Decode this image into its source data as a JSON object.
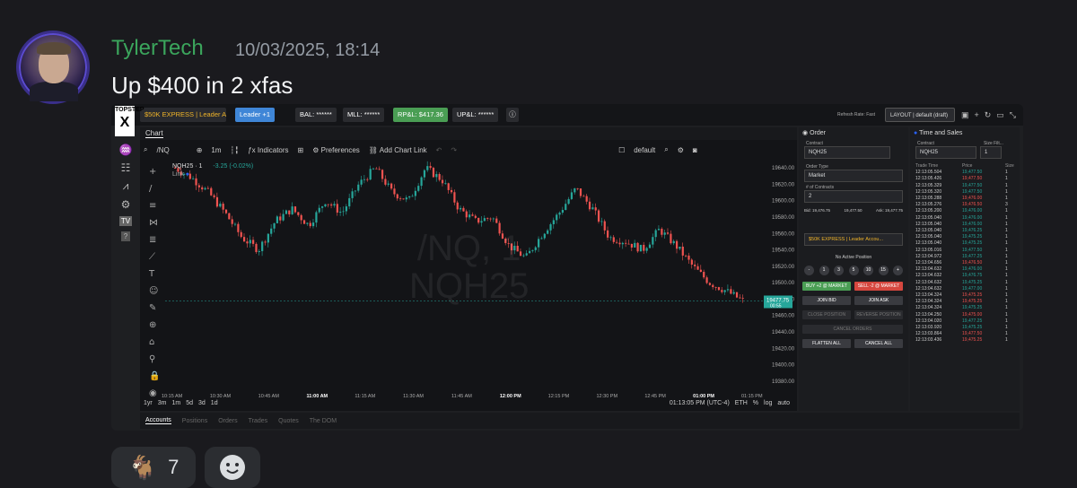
{
  "post": {
    "username": "TylerTech",
    "timestamp": "10/03/2025, 18:14",
    "message": "Up $400 in 2 xfas"
  },
  "reactions": [
    {
      "emoji": "🐐",
      "count": "7"
    },
    {
      "emoji": "smiley-icon",
      "count": ""
    }
  ],
  "platform": {
    "logo_top": "TOPSTEP",
    "logo_x": "X",
    "account_select": "$50K EXPRESS | Leader Acco...",
    "leader_button": "Leader +1",
    "bal": "BAL: ******",
    "mll": "MLL: ******",
    "rpl": "RP&L: $417.36",
    "upl": "UP&L: ******",
    "refresh_note": "Refresh Rate: Fast",
    "layout_select": "LAYOUT | default (draft)"
  },
  "chart": {
    "tab": "Chart",
    "symbol": "/NQ",
    "interval": "1m",
    "indicators": "Indicators",
    "preferences": "Preferences",
    "add_chart_link": "Add Chart Link",
    "default_label": "default",
    "legend_title": "NQH25 · 1",
    "legend_change": "-3.25 (-0.02%)",
    "link_label": "Link",
    "watermark_line1": "/NQ, 1",
    "watermark_line2": "NQH25",
    "last_price": "19477.75",
    "last_time": "00:55",
    "footer_ranges": [
      "1yr",
      "3m",
      "1m",
      "5d",
      "3d",
      "1d"
    ],
    "footer_clock": "01:13:05 PM (UTC-4)",
    "footer_eth": "ETH",
    "footer_pct": "%",
    "footer_log": "log",
    "footer_auto": "auto"
  },
  "chart_data": {
    "type": "candlestick",
    "symbol": "NQH25",
    "x": [
      "10:15 AM",
      "10:30 AM",
      "10:45 AM",
      "11:00 AM",
      "11:15 AM",
      "11:30 AM",
      "11:45 AM",
      "12:00 PM",
      "12:15 PM",
      "12:30 PM",
      "12:45 PM",
      "01:00 PM",
      "01:15 PM"
    ],
    "y_ticks": [
      19380,
      19400,
      19420,
      19440,
      19460,
      19480,
      19500,
      19520,
      19540,
      19560,
      19580,
      19600,
      19620,
      19640
    ],
    "ylim": [
      19370,
      19650
    ],
    "close_path": [
      19640,
      19628,
      19610,
      19585,
      19555,
      19540,
      19575,
      19590,
      19570,
      19600,
      19585,
      19620,
      19640,
      19610,
      19600,
      19640,
      19625,
      19590,
      19575,
      19580,
      19545,
      19530,
      19560,
      19585,
      19615,
      19590,
      19555,
      19550,
      19540,
      19565,
      19545,
      19520,
      19500,
      19490,
      19477.75
    ],
    "last": 19477.75
  },
  "order": {
    "title": "Order",
    "contract_label": "Contract",
    "contract": "NQH25",
    "order_type_label": "Order Type",
    "order_type": "Market",
    "qty_label": "# of Contracts",
    "qty": "2",
    "bid": "Bid: 19,476.75",
    "mid": "19,477.50",
    "mid2": "1.00",
    "ask": "Ask: 19,477.75",
    "account": "$50K EXPRESS | Leader Accou...",
    "no_position": "No Active Position",
    "qty_buttons": [
      "-",
      "1",
      "3",
      "5",
      "10",
      "15",
      "+"
    ],
    "buy": "BUY +2 @ MARKET",
    "sell": "SELL -2 @ MARKET",
    "join_bid": "JOIN BID",
    "join_ask": "JOIN ASK",
    "close_position": "CLOSE POSITION",
    "reverse_position": "REVERSE POSITION",
    "cancel_orders": "CANCEL ORDERS",
    "flatten": "FLATTEN ALL",
    "cancel_all": "CANCEL ALL"
  },
  "ts": {
    "title": "Time and Sales",
    "contract_label": "Contract",
    "contract": "NQH25",
    "size_filter_label": "Size Filt...",
    "size_filter": "1",
    "col_time": "Trade Time",
    "col_price": "Price",
    "col_size": "Size",
    "rows": [
      [
        "12:13:05.504",
        "19,477.50",
        "1",
        "g"
      ],
      [
        "12:13:05.426",
        "19,477.50",
        "1",
        "r"
      ],
      [
        "12:13:05.329",
        "19,477.50",
        "1",
        "g"
      ],
      [
        "12:13:05.320",
        "19,477.50",
        "1",
        "g"
      ],
      [
        "12:13:05.288",
        "19,476.00",
        "1",
        "r"
      ],
      [
        "12:13:05.276",
        "19,476.50",
        "3",
        "r"
      ],
      [
        "12:13:05.200",
        "19,476.00",
        "1",
        "g"
      ],
      [
        "12:13:05.040",
        "19,476.00",
        "1",
        "g"
      ],
      [
        "12:13:05.040",
        "19,476.00",
        "1",
        "g"
      ],
      [
        "12:13:05.040",
        "19,476.25",
        "1",
        "g"
      ],
      [
        "12:13:05.040",
        "19,475.25",
        "1",
        "g"
      ],
      [
        "12:13:05.040",
        "19,475.25",
        "1",
        "g"
      ],
      [
        "12:13:05.016",
        "19,477.50",
        "1",
        "g"
      ],
      [
        "12:13:04.972",
        "19,477.25",
        "1",
        "g"
      ],
      [
        "12:13:04.656",
        "19,476.50",
        "1",
        "r"
      ],
      [
        "12:13:04.632",
        "19,476.00",
        "1",
        "g"
      ],
      [
        "12:13:04.632",
        "19,476.75",
        "1",
        "g"
      ],
      [
        "12:13:04.632",
        "19,475.25",
        "1",
        "g"
      ],
      [
        "12:13:04.632",
        "19,477.00",
        "1",
        "g"
      ],
      [
        "12:13:04.324",
        "19,475.25",
        "1",
        "r"
      ],
      [
        "12:13:04.324",
        "19,475.25",
        "1",
        "r"
      ],
      [
        "12:13:04.324",
        "19,475.25",
        "1",
        "g"
      ],
      [
        "12:13:04.250",
        "19,475.00",
        "1",
        "r"
      ],
      [
        "12:13:04.020",
        "19,477.25",
        "1",
        "g"
      ],
      [
        "12:13:03.920",
        "19,475.25",
        "1",
        "g"
      ],
      [
        "12:13:03.864",
        "19,477.50",
        "1",
        "r"
      ],
      [
        "12:13:03.436",
        "19,475.25",
        "1",
        "r"
      ]
    ]
  },
  "bottom": {
    "tabs": [
      "Accounts",
      "Positions",
      "Orders",
      "Trades",
      "Quotes",
      "The DOM"
    ]
  },
  "colors": {
    "up": "#26a69a",
    "down": "#ef5350",
    "accent": "#2962ff"
  }
}
